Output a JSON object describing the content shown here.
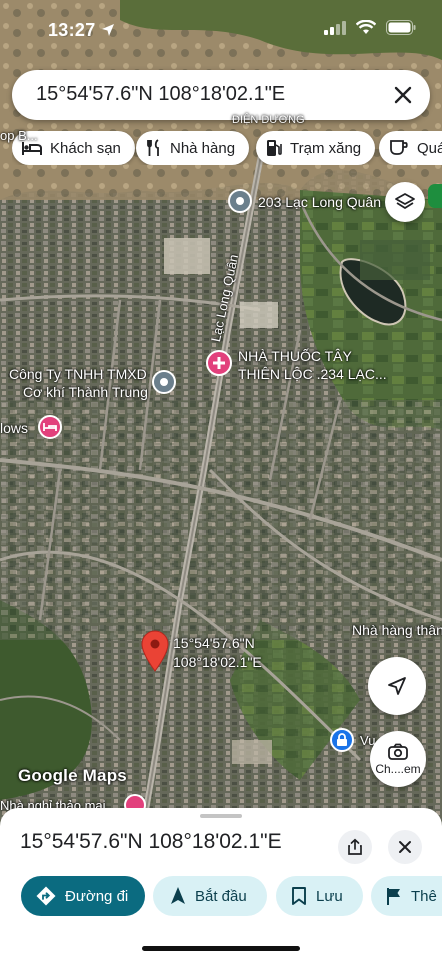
{
  "status_bar": {
    "time": "13:27"
  },
  "search": {
    "query": "15°54'57.6\"N 108°18'02.1\"E"
  },
  "chips": [
    {
      "label": "Khách sạn",
      "icon": "hotel-icon"
    },
    {
      "label": "Nhà hàng",
      "icon": "restaurant-icon"
    },
    {
      "label": "Trạm xăng",
      "icon": "gas-station-icon"
    },
    {
      "label": "Quán",
      "icon": "cafe-icon"
    }
  ],
  "map": {
    "labels": {
      "top_road": "ĐIỆN DƯƠNG",
      "top_left_partial": "op B...",
      "road_name": "Lạc Long Quân",
      "place_203": "203 Lạc Long Quân",
      "company_line1": "Công Ty TNHH TMXD",
      "company_line2": "Cơ khí Thành Trung",
      "bungalows": "lows",
      "pharmacy_line1": "NHÀ THUỐC TÂY",
      "pharmacy_line2": "THIÊN LỘC .234 LẠC...",
      "restaurant_right": "Nhà hàng thân",
      "pin_line1": "15°54'57.6\"N",
      "pin_line2": "108°18'02.1\"E",
      "bottom_left": "Nhà nghỉ thảo mai",
      "bottom_right": "Vu...ất Tr",
      "google_maps": "Google Maps",
      "camera_label": "Ch....em"
    },
    "colors": {
      "pin": "#ea4335",
      "poi_gray": "#6b7f8c",
      "poi_pink": "#e2407c",
      "poi_blue": "#1a73e8"
    }
  },
  "sheet": {
    "title": "15°54'57.6\"N 108°18'02.1\"E",
    "actions": [
      {
        "label": "Đường đi",
        "icon": "directions-icon",
        "primary": true
      },
      {
        "label": "Bắt đầu",
        "icon": "navigation-arrow-icon",
        "primary": false
      },
      {
        "label": "Lưu",
        "icon": "bookmark-icon",
        "primary": false
      },
      {
        "label": "Thê",
        "icon": "flag-icon",
        "primary": false
      }
    ],
    "colors": {
      "primary_bg": "#0b6b80",
      "secondary_bg": "#d9f1f5",
      "secondary_fg": "#0b3f4d"
    }
  }
}
